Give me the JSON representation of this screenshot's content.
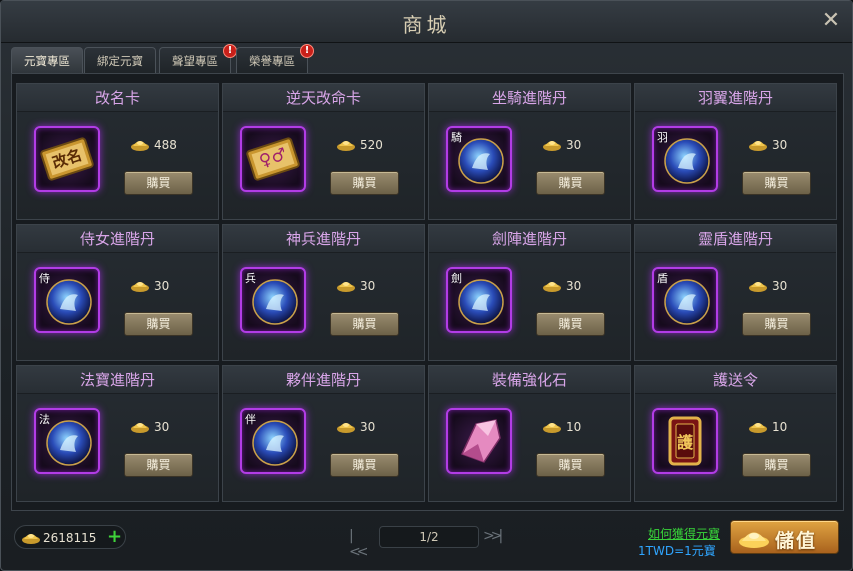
{
  "window": {
    "title": "商城",
    "close_symbol": "✕"
  },
  "tabs": [
    {
      "label": "元寶專區",
      "active": true,
      "alert": false
    },
    {
      "label": "綁定元寶",
      "active": false,
      "alert": false
    },
    {
      "label": "聲望專區",
      "active": false,
      "alert": true
    },
    {
      "label": "榮譽專區",
      "active": false,
      "alert": true
    }
  ],
  "alert_mark": "!",
  "buy_label": "購買",
  "items": [
    {
      "name": "改名卡",
      "price": "488",
      "icon": "rename-card-icon",
      "glyph": "改名",
      "corner": ""
    },
    {
      "name": "逆天改命卡",
      "price": "520",
      "icon": "gender-change-card-icon",
      "glyph": "♀♂",
      "corner": ""
    },
    {
      "name": "坐騎進階丹",
      "price": "30",
      "icon": "mount-pill-icon",
      "glyph": "",
      "corner": "騎"
    },
    {
      "name": "羽翼進階丹",
      "price": "30",
      "icon": "wings-pill-icon",
      "glyph": "",
      "corner": "羽"
    },
    {
      "name": "侍女進階丹",
      "price": "30",
      "icon": "maid-pill-icon",
      "glyph": "",
      "corner": "侍"
    },
    {
      "name": "神兵進階丹",
      "price": "30",
      "icon": "weapon-pill-icon",
      "glyph": "",
      "corner": "兵"
    },
    {
      "name": "劍陣進階丹",
      "price": "30",
      "icon": "sword-array-pill-icon",
      "glyph": "",
      "corner": "劍"
    },
    {
      "name": "靈盾進階丹",
      "price": "30",
      "icon": "spirit-shield-pill-icon",
      "glyph": "",
      "corner": "盾"
    },
    {
      "name": "法寶進階丹",
      "price": "30",
      "icon": "treasure-pill-icon",
      "glyph": "",
      "corner": "法"
    },
    {
      "name": "夥伴進階丹",
      "price": "30",
      "icon": "partner-pill-icon",
      "glyph": "",
      "corner": "伴"
    },
    {
      "name": "裝備強化石",
      "price": "10",
      "icon": "enhance-crystal-icon",
      "glyph": "",
      "corner": ""
    },
    {
      "name": "護送令",
      "price": "10",
      "icon": "escort-token-icon",
      "glyph": "護",
      "corner": ""
    }
  ],
  "footer": {
    "balance": "2618115",
    "plus_symbol": "+",
    "page": "1/2",
    "prev_symbol": "|<<",
    "next_symbol": ">>|",
    "how_to_get": "如何獲得元寶",
    "rate": "1TWD=1元寶",
    "topup_label": "儲值"
  },
  "colors": {
    "item_title": "#d8a5e8",
    "frame_glow": "#b23ce6",
    "link_green": "#38d43a",
    "rate_blue": "#2fa5ff"
  }
}
